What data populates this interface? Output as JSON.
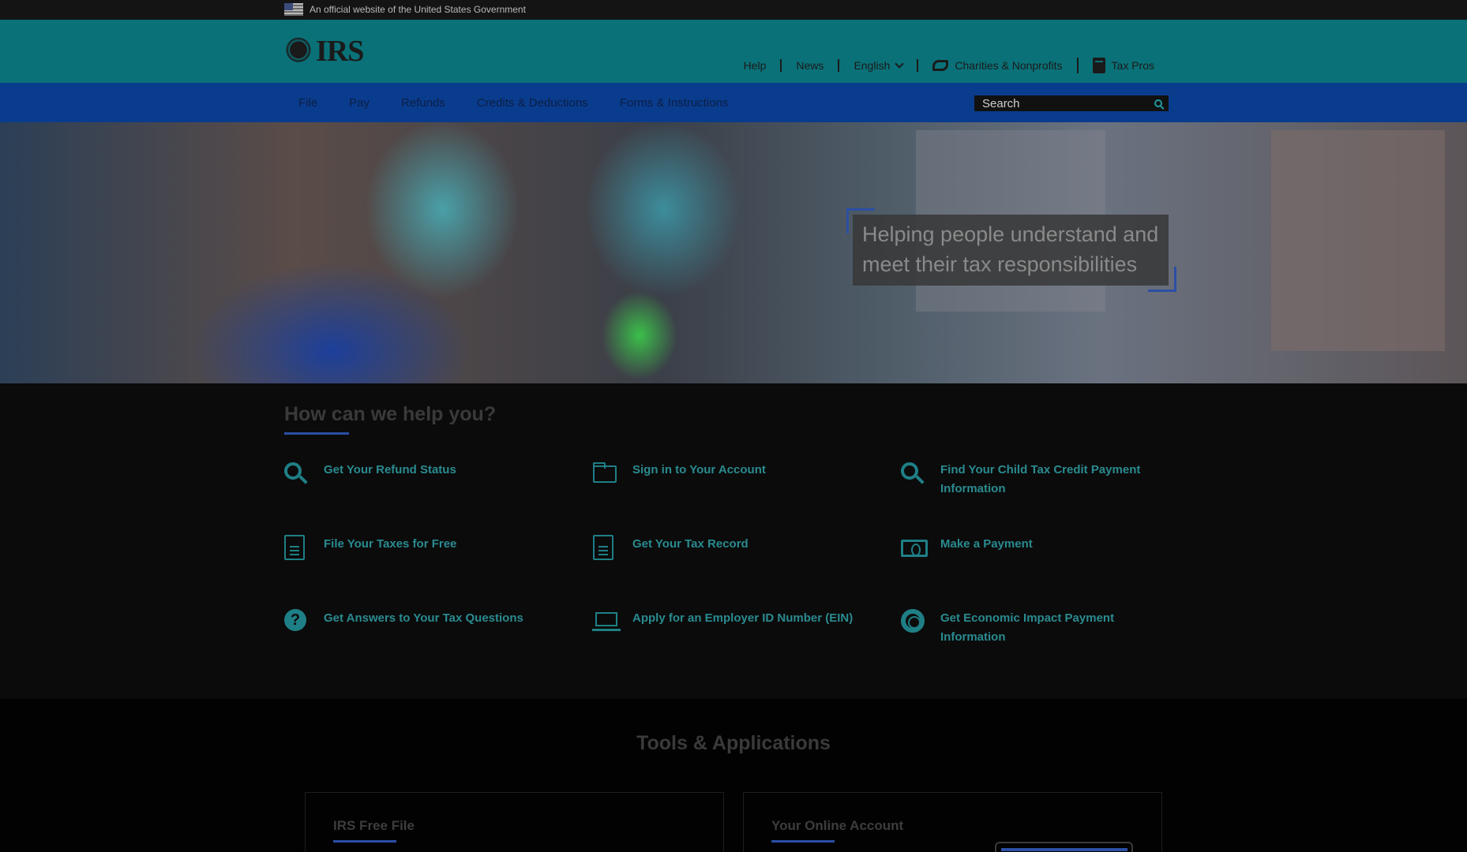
{
  "gov_banner": {
    "text": "An official website of the United States Government"
  },
  "header": {
    "logo_text": "IRS",
    "util_nav": [
      {
        "label": "Help"
      },
      {
        "label": "News"
      },
      {
        "label": "English"
      },
      {
        "label": "Charities & Nonprofits"
      },
      {
        "label": "Tax Pros"
      }
    ]
  },
  "main_nav": {
    "items": [
      {
        "label": "File"
      },
      {
        "label": "Pay"
      },
      {
        "label": "Refunds"
      },
      {
        "label": "Credits & Deductions"
      },
      {
        "label": "Forms & Instructions"
      }
    ],
    "search_placeholder": "Search"
  },
  "hero": {
    "caption_line1": "Helping people understand and",
    "caption_line2": "meet their tax responsibilities"
  },
  "help": {
    "title": "How can we help you?",
    "items": [
      {
        "label": "Get Your Refund Status",
        "icon": "search-icon"
      },
      {
        "label": "Sign in to Your Account",
        "icon": "folder-icon"
      },
      {
        "label": "Find Your Child Tax Credit Payment",
        "label2": "Information",
        "icon": "search-icon"
      },
      {
        "label": "File Your Taxes for Free",
        "icon": "document-icon"
      },
      {
        "label": "Get Your Tax Record",
        "icon": "document-icon"
      },
      {
        "label": "Make a Payment",
        "icon": "dollar-bill-icon"
      },
      {
        "label": "Get Answers to Your Tax Questions",
        "icon": "question-icon"
      },
      {
        "label": "Apply for an Employer ID Number (EIN)",
        "icon": "laptop-icon"
      },
      {
        "label": "Get Economic Impact Payment",
        "label2": "Information",
        "icon": "lifebuoy-icon"
      }
    ]
  },
  "tools": {
    "title": "Tools & Applications",
    "cards": [
      {
        "title": "IRS Free File"
      },
      {
        "title": "Your Online Account"
      }
    ]
  },
  "colors": {
    "header_teal": "#0a7178",
    "nav_blue": "#0a3c8e",
    "link_teal": "#2a8b90",
    "accent_blue": "#2b4fa5"
  }
}
